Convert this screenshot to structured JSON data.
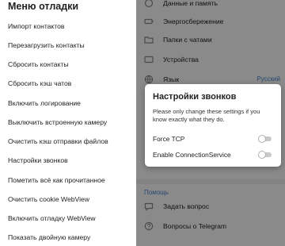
{
  "drawer": {
    "title": "Меню отладки",
    "items": [
      "Импорт контактов",
      "Перезагрузить контакты",
      "Сбросить контакты",
      "Сбросить кэш чатов",
      "Включить логирование",
      "Выключить встроенную камеру",
      "Очистить кэш отправки файлов",
      "Настройки звонков",
      "Пометить всё как прочитанное",
      "Очистить cookie WebView",
      "Включить отладку WebView",
      "Показать двойную камеру"
    ]
  },
  "settings": {
    "rows": [
      {
        "label": "Данные и память",
        "icon": "data-icon"
      },
      {
        "label": "Энергосбережение",
        "icon": "battery-icon"
      },
      {
        "label": "Папки с чатами",
        "icon": "folder-icon"
      },
      {
        "label": "Устройства",
        "icon": "devices-icon"
      },
      {
        "label": "Язык",
        "icon": "globe-icon",
        "value": "Русский"
      }
    ],
    "help_header": "Помощь",
    "help_rows": [
      {
        "label": "Задать вопрос",
        "icon": "chat-icon"
      },
      {
        "label": "Вопросы о Telegram",
        "icon": "help-icon"
      }
    ]
  },
  "dialog": {
    "title": "Настройки звонков",
    "text": "Please only change these settings if you know exactly what they do.",
    "options": [
      {
        "label": "Force TCP",
        "enabled": false
      },
      {
        "label": "Enable ConnectionService",
        "enabled": false
      }
    ]
  },
  "colors": {
    "accent": "#4a8ad0",
    "dim_overlay": "rgba(0,0,0,0.46)"
  }
}
